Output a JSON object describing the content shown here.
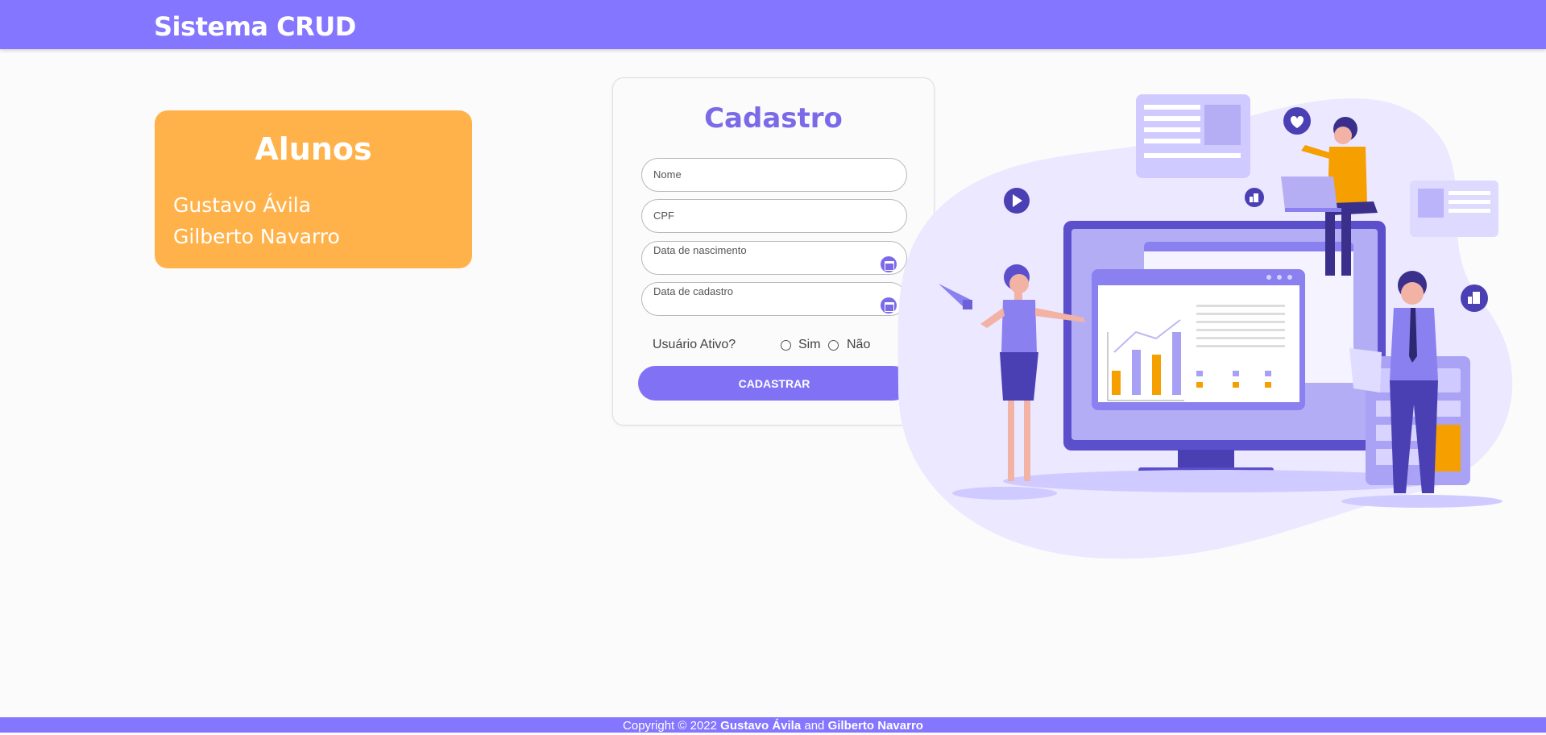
{
  "header": {
    "title": "Sistema CRUD"
  },
  "students": {
    "title": "Alunos",
    "items": [
      "Gustavo Ávila",
      "Gilberto Navarro"
    ]
  },
  "form": {
    "title": "Cadastro",
    "name_placeholder": "Nome",
    "cpf_placeholder": "CPF",
    "birth_label": "Data de nascimento",
    "signup_label": "Data de cadastro",
    "active_label": "Usuário Ativo?",
    "yes_label": "Sim",
    "no_label": "Não",
    "submit_label": "CADASTRAR"
  },
  "footer": {
    "prefix": "Copyright © 2022",
    "author1": "Gustavo Ávila",
    "joiner": "and",
    "author2": "Gilberto Navarro"
  },
  "colors": {
    "brand": "#8576ff",
    "accent": "#7b6ae8",
    "students_card": "#ffb24a"
  }
}
